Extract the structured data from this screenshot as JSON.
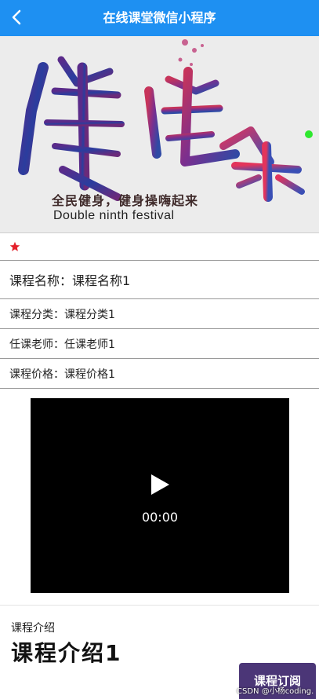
{
  "nav": {
    "title": "在线课堂微信小程序",
    "back_icon": "chevron-left-icon"
  },
  "banner": {
    "title_art": "健身操",
    "subtitle": "全民健身，健身操嗨起来",
    "english": "Double ninth festival",
    "indicator_color": "#2ee82e"
  },
  "course": {
    "favorite_icon": "star-icon",
    "name_label": "课程名称：",
    "name_value": "课程名称1",
    "category_label": "课程分类：",
    "category_value": "课程分类1",
    "teacher_label": "任课老师：",
    "teacher_value": "任课老师1",
    "price_label": "课程价格：",
    "price_value": "课程价格1"
  },
  "video": {
    "time": "00:00",
    "play_icon": "play-icon"
  },
  "intro": {
    "label": "课程介绍",
    "content": "课程介绍1"
  },
  "subscribe_button": "课程订阅",
  "watermark": "CSDN @小杨coding.",
  "colors": {
    "nav_bg": "#1e90f2",
    "star": "#e4212b",
    "button_bg": "#4b3677"
  }
}
